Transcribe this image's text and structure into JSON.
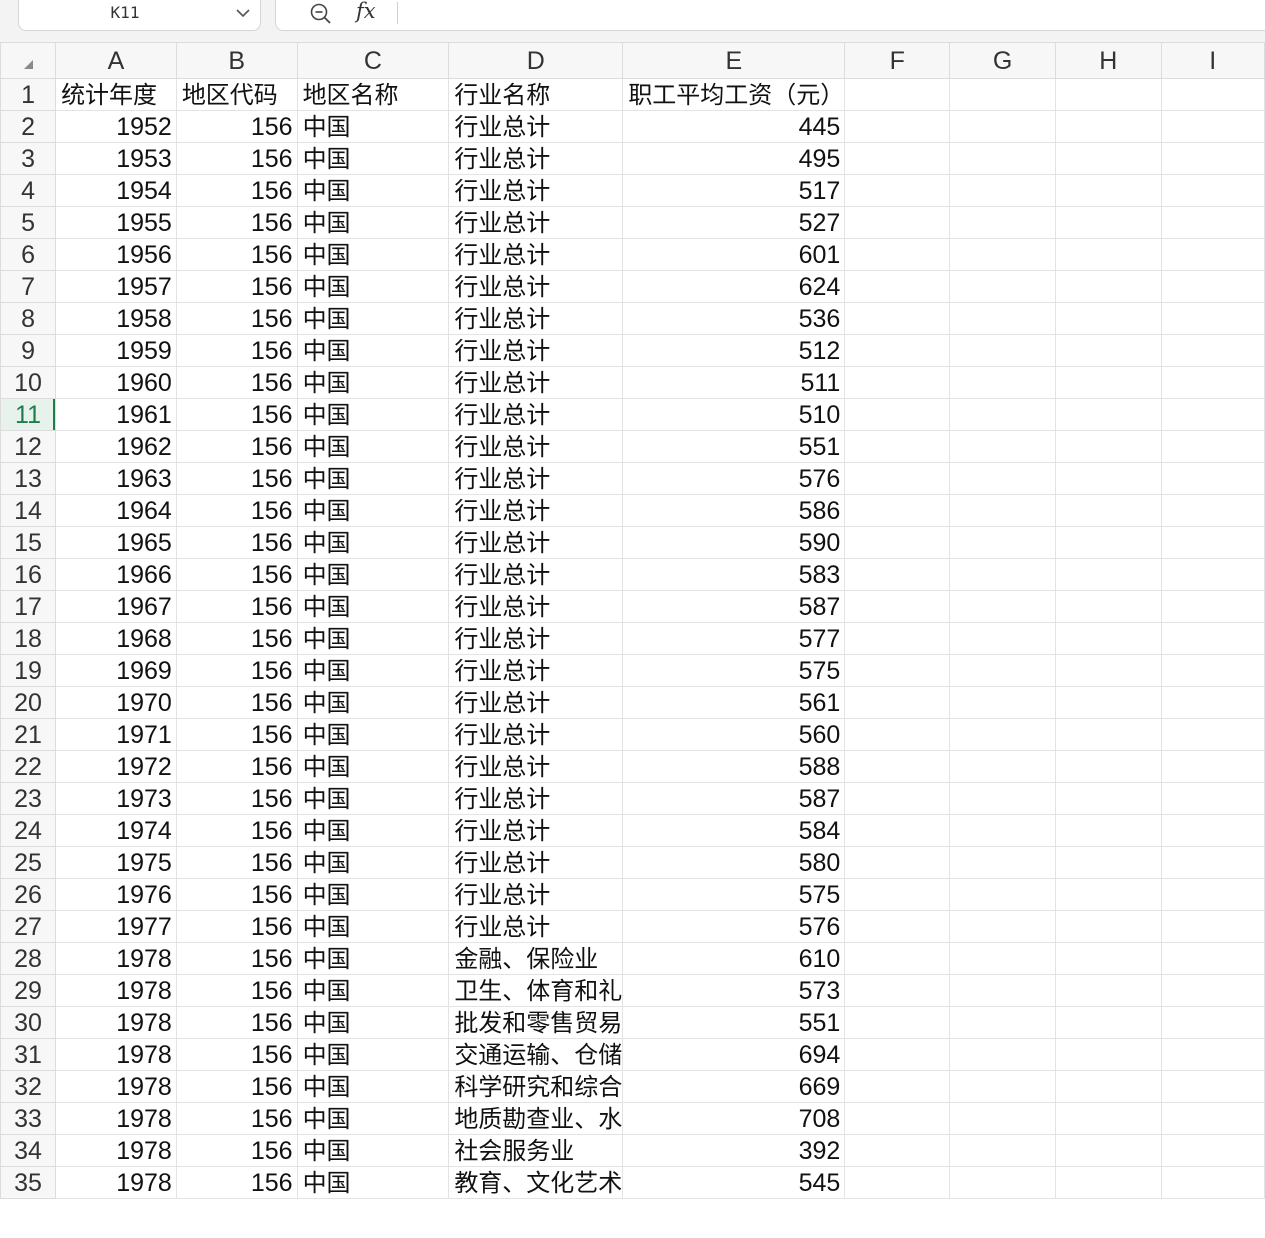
{
  "name_box": {
    "value": "K11"
  },
  "formula_bar": {
    "fx_label": "fx",
    "content": ""
  },
  "columns": [
    "A",
    "B",
    "C",
    "D",
    "E",
    "F",
    "G",
    "H",
    "I"
  ],
  "active_row": 11,
  "rows": [
    {
      "num": "1",
      "cells": [
        "统计年度",
        "地区代码",
        "地区名称",
        "行业名称",
        "职工平均工资（元）"
      ]
    },
    {
      "num": "2",
      "cells": [
        "1952",
        "156",
        "中国",
        "行业总计",
        "445"
      ]
    },
    {
      "num": "3",
      "cells": [
        "1953",
        "156",
        "中国",
        "行业总计",
        "495"
      ]
    },
    {
      "num": "4",
      "cells": [
        "1954",
        "156",
        "中国",
        "行业总计",
        "517"
      ]
    },
    {
      "num": "5",
      "cells": [
        "1955",
        "156",
        "中国",
        "行业总计",
        "527"
      ]
    },
    {
      "num": "6",
      "cells": [
        "1956",
        "156",
        "中国",
        "行业总计",
        "601"
      ]
    },
    {
      "num": "7",
      "cells": [
        "1957",
        "156",
        "中国",
        "行业总计",
        "624"
      ]
    },
    {
      "num": "8",
      "cells": [
        "1958",
        "156",
        "中国",
        "行业总计",
        "536"
      ]
    },
    {
      "num": "9",
      "cells": [
        "1959",
        "156",
        "中国",
        "行业总计",
        "512"
      ]
    },
    {
      "num": "10",
      "cells": [
        "1960",
        "156",
        "中国",
        "行业总计",
        "511"
      ]
    },
    {
      "num": "11",
      "cells": [
        "1961",
        "156",
        "中国",
        "行业总计",
        "510"
      ]
    },
    {
      "num": "12",
      "cells": [
        "1962",
        "156",
        "中国",
        "行业总计",
        "551"
      ]
    },
    {
      "num": "13",
      "cells": [
        "1963",
        "156",
        "中国",
        "行业总计",
        "576"
      ]
    },
    {
      "num": "14",
      "cells": [
        "1964",
        "156",
        "中国",
        "行业总计",
        "586"
      ]
    },
    {
      "num": "15",
      "cells": [
        "1965",
        "156",
        "中国",
        "行业总计",
        "590"
      ]
    },
    {
      "num": "16",
      "cells": [
        "1966",
        "156",
        "中国",
        "行业总计",
        "583"
      ]
    },
    {
      "num": "17",
      "cells": [
        "1967",
        "156",
        "中国",
        "行业总计",
        "587"
      ]
    },
    {
      "num": "18",
      "cells": [
        "1968",
        "156",
        "中国",
        "行业总计",
        "577"
      ]
    },
    {
      "num": "19",
      "cells": [
        "1969",
        "156",
        "中国",
        "行业总计",
        "575"
      ]
    },
    {
      "num": "20",
      "cells": [
        "1970",
        "156",
        "中国",
        "行业总计",
        "561"
      ]
    },
    {
      "num": "21",
      "cells": [
        "1971",
        "156",
        "中国",
        "行业总计",
        "560"
      ]
    },
    {
      "num": "22",
      "cells": [
        "1972",
        "156",
        "中国",
        "行业总计",
        "588"
      ]
    },
    {
      "num": "23",
      "cells": [
        "1973",
        "156",
        "中国",
        "行业总计",
        "587"
      ]
    },
    {
      "num": "24",
      "cells": [
        "1974",
        "156",
        "中国",
        "行业总计",
        "584"
      ]
    },
    {
      "num": "25",
      "cells": [
        "1975",
        "156",
        "中国",
        "行业总计",
        "580"
      ]
    },
    {
      "num": "26",
      "cells": [
        "1976",
        "156",
        "中国",
        "行业总计",
        "575"
      ]
    },
    {
      "num": "27",
      "cells": [
        "1977",
        "156",
        "中国",
        "行业总计",
        "576"
      ]
    },
    {
      "num": "28",
      "cells": [
        "1978",
        "156",
        "中国",
        "金融、保险业",
        "610"
      ]
    },
    {
      "num": "29",
      "cells": [
        "1978",
        "156",
        "中国",
        "卫生、体育和礼",
        "573"
      ]
    },
    {
      "num": "30",
      "cells": [
        "1978",
        "156",
        "中国",
        "批发和零售贸易",
        "551"
      ]
    },
    {
      "num": "31",
      "cells": [
        "1978",
        "156",
        "中国",
        "交通运输、仓储",
        "694"
      ]
    },
    {
      "num": "32",
      "cells": [
        "1978",
        "156",
        "中国",
        "科学研究和综合",
        "669"
      ]
    },
    {
      "num": "33",
      "cells": [
        "1978",
        "156",
        "中国",
        "地质勘查业、水",
        "708"
      ]
    },
    {
      "num": "34",
      "cells": [
        "1978",
        "156",
        "中国",
        "社会服务业",
        "392"
      ]
    },
    {
      "num": "35",
      "cells": [
        "1978",
        "156",
        "中国",
        "教育、文化艺术",
        "545"
      ]
    }
  ]
}
